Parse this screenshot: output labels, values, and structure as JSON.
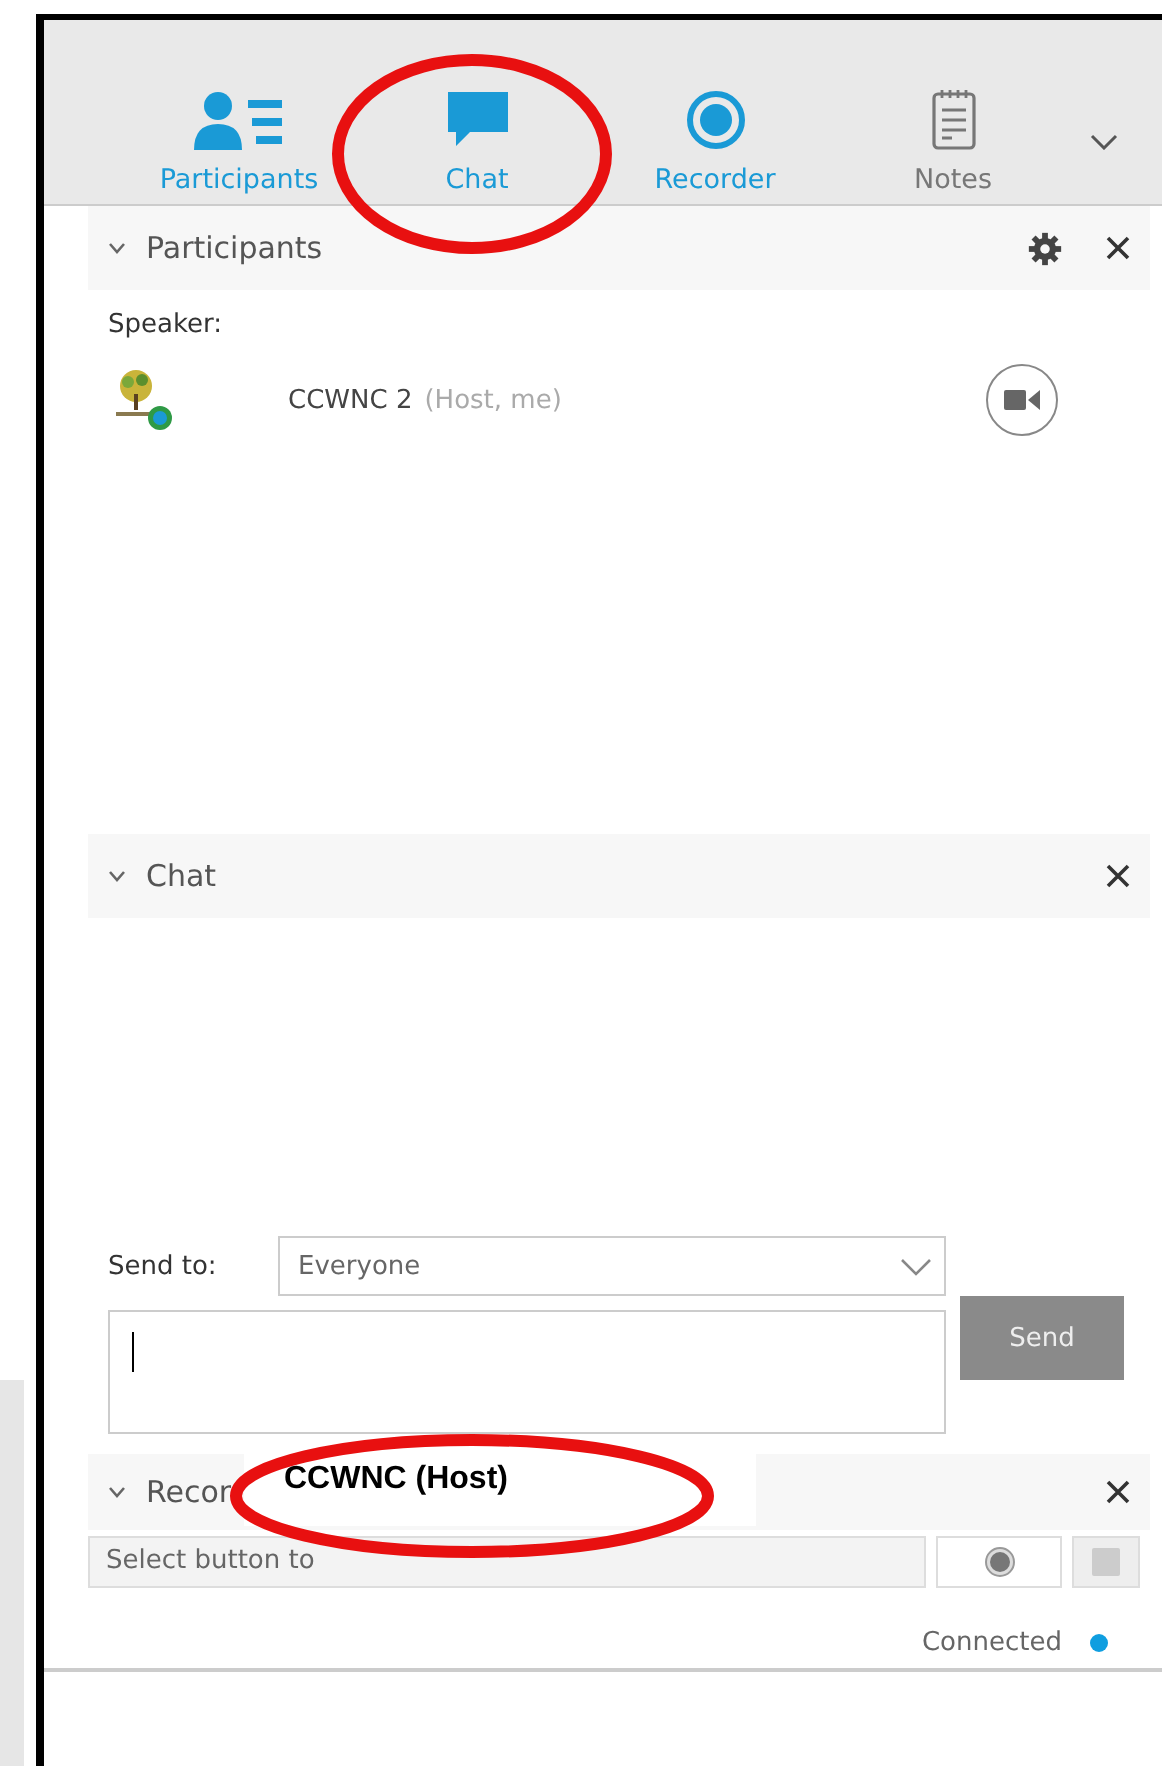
{
  "tabs": [
    {
      "label": "Participants",
      "kind": "participants",
      "open": true
    },
    {
      "label": "Chat",
      "kind": "chat",
      "open": true
    },
    {
      "label": "Recorder",
      "kind": "recorder",
      "open": true
    },
    {
      "label": "Notes",
      "kind": "notes",
      "open": false
    }
  ],
  "participants_panel": {
    "title": "Participants",
    "speaker_label": "Speaker:",
    "participants": [
      {
        "name": "CCWNC 2",
        "role": "(Host, me)"
      }
    ]
  },
  "chat_panel": {
    "title": "Chat",
    "send_to_label": "Send to:",
    "send_to": "Everyone",
    "send_button": "Send"
  },
  "recorder_panel": {
    "title": "Recor",
    "status_field": "Select button to"
  },
  "status": {
    "text": "Connected",
    "color": "#0f9ee0"
  },
  "annotation": {
    "label": "CCWNC (Host)"
  }
}
